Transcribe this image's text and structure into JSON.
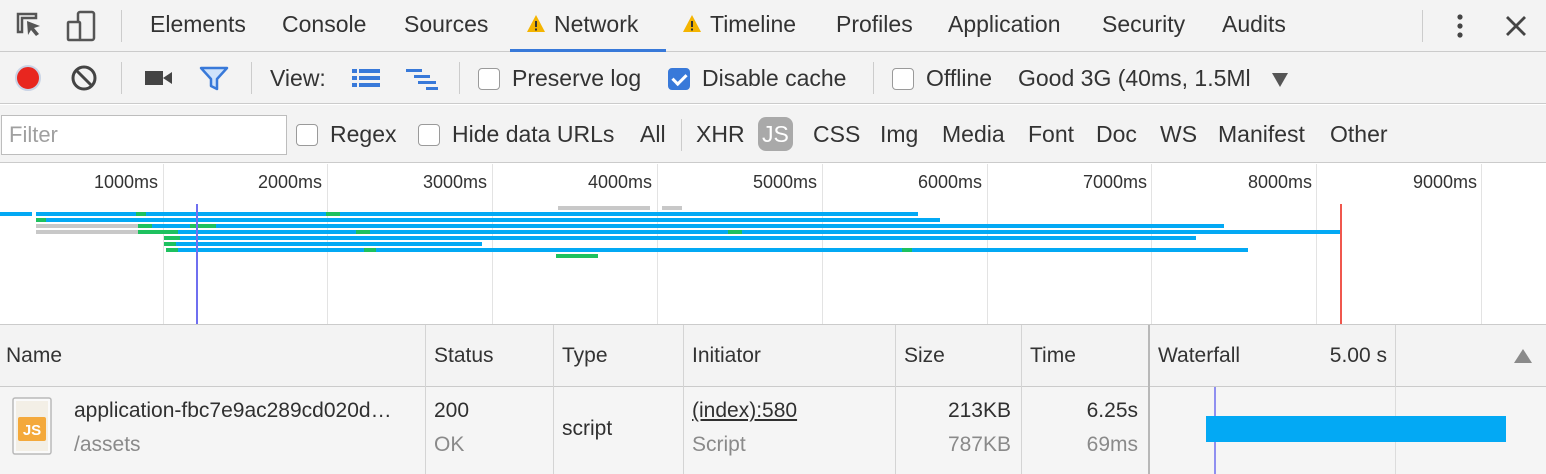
{
  "tabs": [
    {
      "label": "Elements"
    },
    {
      "label": "Console"
    },
    {
      "label": "Sources"
    },
    {
      "label": "Network"
    },
    {
      "label": "Timeline"
    },
    {
      "label": "Profiles"
    },
    {
      "label": "Application"
    },
    {
      "label": "Security"
    },
    {
      "label": "Audits"
    }
  ],
  "toolbar": {
    "view_label": "View:",
    "preserve_log": {
      "label": "Preserve log",
      "checked": false
    },
    "disable_cache": {
      "label": "Disable cache",
      "checked": true
    },
    "offline": {
      "label": "Offline",
      "checked": false
    },
    "throttle": "Good 3G (40ms, 1.5Ml"
  },
  "filter": {
    "placeholder": "Filter",
    "regex_label": "Regex",
    "hide_data_urls_label": "Hide data URLs",
    "types": [
      "All",
      "XHR",
      "JS",
      "CSS",
      "Img",
      "Media",
      "Font",
      "Doc",
      "WS",
      "Manifest",
      "Other"
    ],
    "selected_type": "JS"
  },
  "overview": {
    "ticks": [
      "1000ms",
      "2000ms",
      "3000ms",
      "4000ms",
      "5000ms",
      "6000ms",
      "7000ms",
      "8000ms",
      "9000ms"
    ]
  },
  "table": {
    "columns": {
      "name": "Name",
      "status": "Status",
      "type": "Type",
      "initiator": "Initiator",
      "size": "Size",
      "time": "Time",
      "waterfall": "Waterfall",
      "waterfall_scale": "5.00 s"
    },
    "rows": [
      {
        "name": "application-fbc7e9ac289cd020d…",
        "path": "/assets",
        "status": "200",
        "status_text": "OK",
        "type": "script",
        "initiator": "(index):580",
        "initiator_type": "Script",
        "size": "213KB",
        "content_size": "787KB",
        "time": "6.25s",
        "latency": "69ms",
        "file_icon_label": "JS"
      }
    ]
  },
  "colors": {
    "accent": "#3879d9",
    "record": "#e8261f",
    "bar_blue": "#03a9f4",
    "bar_green": "#1ec15f",
    "bar_gray": "#c8c8c8",
    "dom_loaded": "#6f6ff0",
    "load_event": "#f0574d",
    "warning": "#f4b400"
  }
}
